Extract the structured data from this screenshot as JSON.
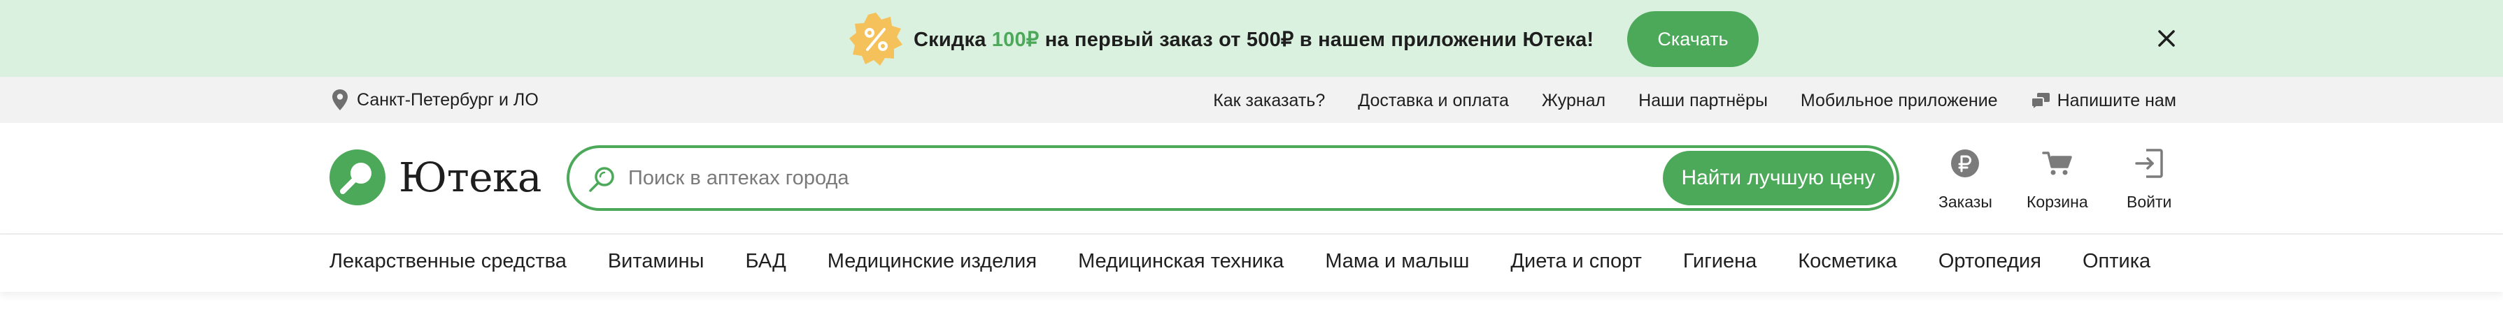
{
  "promo": {
    "badge_icon": "percent-badge-icon",
    "text_before": "Скидка ",
    "text_accent": "100₽",
    "text_after": " на первый заказ от 500₽ в нашем приложении Ютека!",
    "button_label": "Скачать",
    "close_icon": "close-icon",
    "background_color": "#dbf1df"
  },
  "infobar": {
    "city_icon": "location-pin-icon",
    "city": "Санкт-Петербург и ЛО",
    "links": [
      "Как заказать?",
      "Доставка и оплата",
      "Журнал",
      "Наши партнёры",
      "Мобильное приложение"
    ],
    "write_icon": "chat-icon",
    "write_label": "Напишите нам"
  },
  "header": {
    "logo_text": "Ютека",
    "logo_icon": "magnifier-logo-icon",
    "search": {
      "placeholder": "Поиск в аптеках города",
      "value": "",
      "icon": "search-icon",
      "button_label": "Найти лучшую цену"
    },
    "actions": {
      "orders": {
        "label": "Заказы",
        "icon": "ruble-coin-icon"
      },
      "cart": {
        "label": "Корзина",
        "icon": "cart-icon"
      },
      "login": {
        "label": "Войти",
        "icon": "login-icon"
      }
    }
  },
  "categories": [
    "Лекарственные средства",
    "Витамины",
    "БАД",
    "Медицинские изделия",
    "Медицинская техника",
    "Мама и малыш",
    "Диета и спорт",
    "Гигиена",
    "Косметика",
    "Ортопедия",
    "Оптика"
  ],
  "colors": {
    "accent": "#4ca95a",
    "badge": "#f5c15a",
    "icon_gray": "#7b7b7b"
  }
}
